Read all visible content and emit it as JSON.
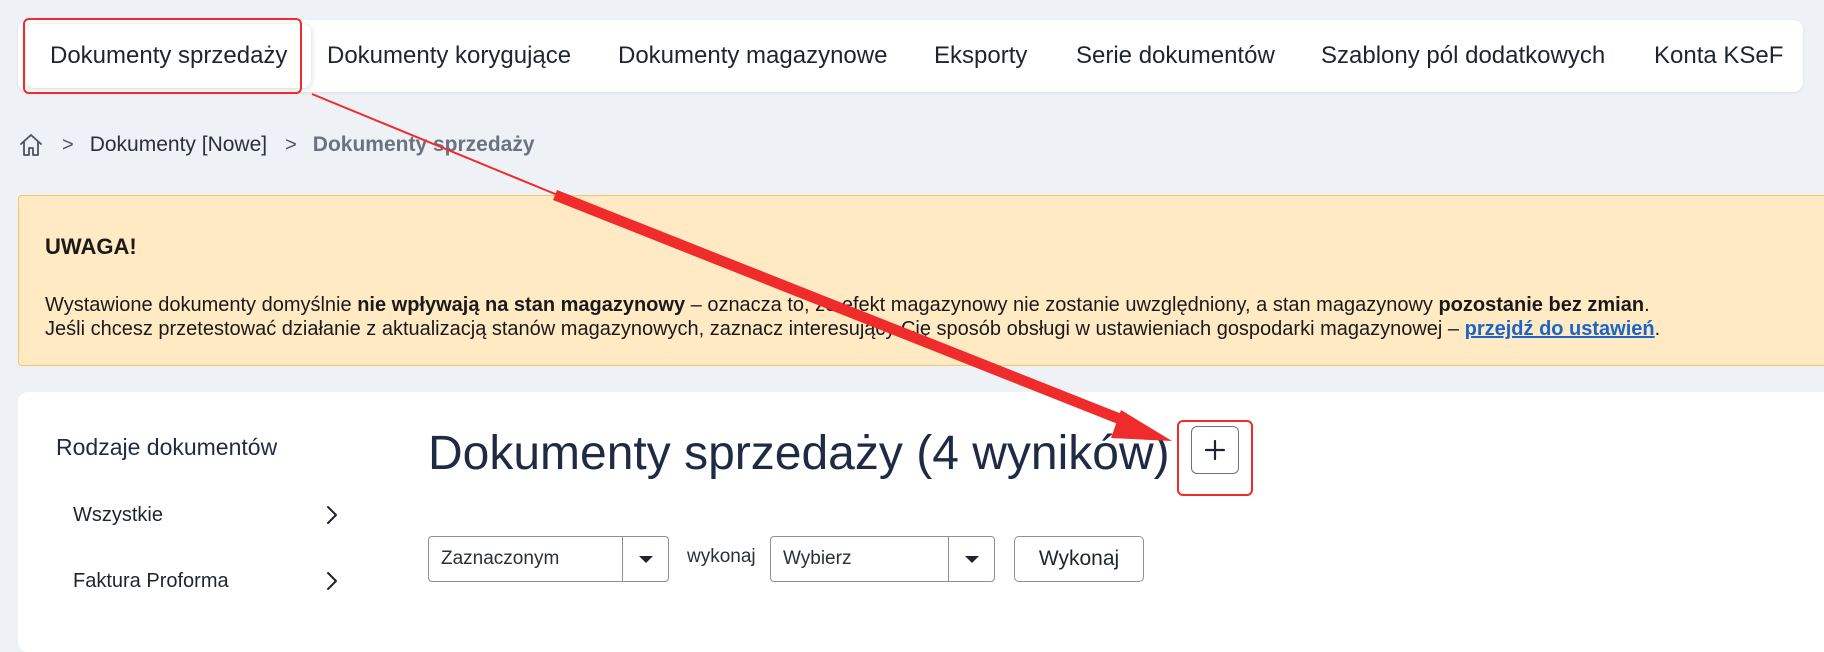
{
  "tabs": [
    {
      "label": "Dokumenty sprzedaży",
      "active": true
    },
    {
      "label": "Dokumenty korygujące",
      "active": false
    },
    {
      "label": "Dokumenty magazynowe",
      "active": false
    },
    {
      "label": "Eksporty",
      "active": false
    },
    {
      "label": "Serie dokumentów",
      "active": false
    },
    {
      "label": "Szablony pól dodatkowych",
      "active": false
    },
    {
      "label": "Konta KSeF",
      "active": false
    }
  ],
  "breadcrumb": {
    "home_icon": "home-icon",
    "items": [
      "Dokumenty [Nowe]",
      "Dokumenty sprzedaży"
    ],
    "separator": ">"
  },
  "alert": {
    "title": "UWAGA!",
    "line1_part1": "Wystawione dokumenty domyślnie ",
    "line1_bold1": "nie wpływają na stan magazynowy",
    "line1_part2": " – oznacza to, że efekt magazynowy nie zostanie uwzględniony, a stan magazynowy ",
    "line1_bold2": "pozostanie bez zmian",
    "line1_part3": ".",
    "line2_part1": "Jeśli chcesz przetestować działanie z aktualizacją stanów magazynowych, zaznacz interesujący Cię sposób obsługi w ustawieniach gospodarki magazynowej – ",
    "line2_link": "przejdź do ustawień",
    "line2_part2": ".",
    "background": "#ffeac4",
    "border": "#f3c86d"
  },
  "sidebar": {
    "title": "Rodzaje dokumentów",
    "items": [
      {
        "label": "Wszystkie",
        "icon": "chevron-right-icon"
      },
      {
        "label": "Faktura Proforma",
        "icon": "chevron-right-icon"
      }
    ]
  },
  "main": {
    "title": "Dokumenty sprzedaży (4 wyników)",
    "add_icon": "plus-icon",
    "bulk": {
      "scope_value": "Zaznaczonym",
      "between_label": "wykonaj",
      "action_value": "Wybierz",
      "execute_label": "Wykonaj"
    }
  },
  "annotation": {
    "color": "#ef2b2b"
  }
}
